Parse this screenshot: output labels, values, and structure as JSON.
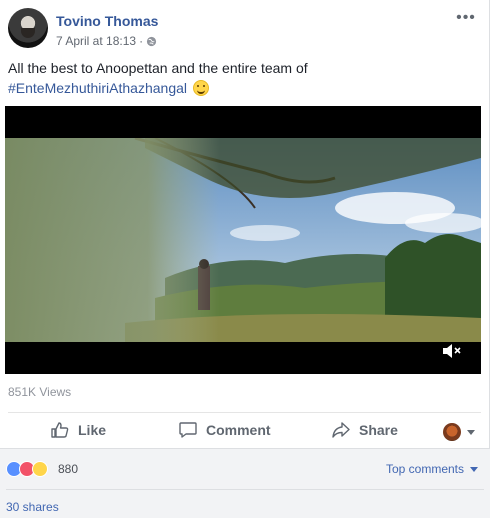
{
  "post": {
    "author": "Tovino Thomas",
    "timestamp": "7 April at 18:13",
    "separator": "·",
    "text_prefix": "All the best to Anoopettan and the entire team of",
    "hashtag": "#EnteMezhuthiriAthazhangal",
    "emoji_icon": "smiling-face-icon",
    "more_options": "•••"
  },
  "video": {
    "muted": true,
    "mute_icon": "speaker-muted-icon"
  },
  "stats": {
    "views": "851K Views",
    "reaction_count": "880",
    "reactions": [
      "like",
      "love",
      "wow"
    ],
    "top_comments": "Top comments",
    "shares": "30 shares"
  },
  "actions": {
    "like": "Like",
    "comment": "Comment",
    "share": "Share"
  },
  "colors": {
    "author_blue": "#365899",
    "link_blue": "#4267b2",
    "muted_text": "#90949c",
    "footer_bg": "#f2f3f5"
  }
}
